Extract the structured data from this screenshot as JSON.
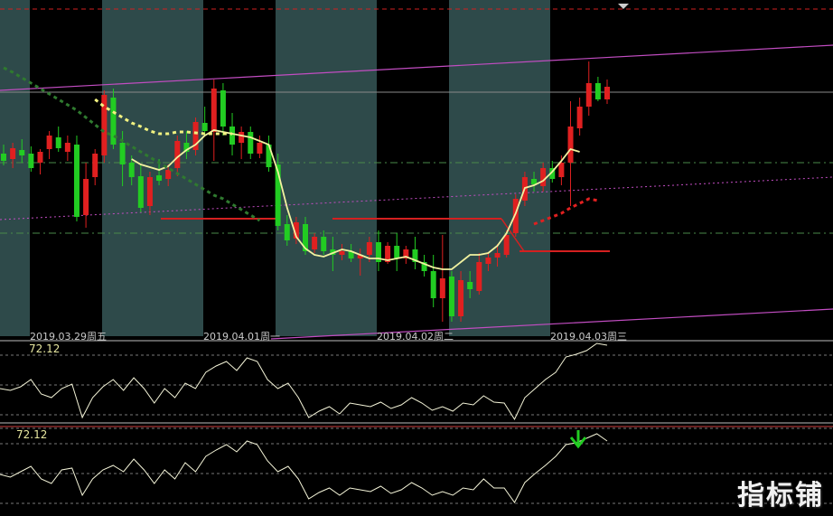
{
  "chart_data": [
    {
      "type": "candlestick",
      "title": "",
      "x_tick_labels": [
        "2019.03.29周五",
        "2019.04.01周一",
        "2019.04.02周二",
        "2019.04.03周三"
      ],
      "session_shading": true,
      "grid": true,
      "candles": [
        {
          "o": 170,
          "h": 160,
          "l": 183,
          "c": 178
        },
        {
          "o": 176,
          "h": 158,
          "l": 186,
          "c": 164
        },
        {
          "o": 166,
          "h": 154,
          "l": 180,
          "c": 172
        },
        {
          "o": 170,
          "h": 162,
          "l": 190,
          "c": 186
        },
        {
          "o": 180,
          "h": 165,
          "l": 193,
          "c": 168
        },
        {
          "o": 165,
          "h": 145,
          "l": 176,
          "c": 150
        },
        {
          "o": 152,
          "h": 140,
          "l": 168,
          "c": 164
        },
        {
          "o": 168,
          "h": 150,
          "l": 178,
          "c": 158
        },
        {
          "o": 160,
          "h": 150,
          "l": 245,
          "c": 240
        },
        {
          "o": 238,
          "h": 180,
          "l": 252,
          "c": 198
        },
        {
          "o": 196,
          "h": 165,
          "l": 205,
          "c": 170
        },
        {
          "o": 172,
          "h": 100,
          "l": 180,
          "c": 105
        },
        {
          "o": 108,
          "h": 98,
          "l": 165,
          "c": 160
        },
        {
          "o": 158,
          "h": 145,
          "l": 206,
          "c": 182
        },
        {
          "o": 180,
          "h": 172,
          "l": 205,
          "c": 196
        },
        {
          "o": 195,
          "h": 182,
          "l": 235,
          "c": 230
        },
        {
          "o": 228,
          "h": 190,
          "l": 238,
          "c": 196
        },
        {
          "o": 194,
          "h": 176,
          "l": 205,
          "c": 200
        },
        {
          "o": 198,
          "h": 182,
          "l": 206,
          "c": 188
        },
        {
          "o": 186,
          "h": 150,
          "l": 195,
          "c": 156
        },
        {
          "o": 158,
          "h": 145,
          "l": 176,
          "c": 168
        },
        {
          "o": 166,
          "h": 130,
          "l": 172,
          "c": 135
        },
        {
          "o": 136,
          "h": 118,
          "l": 150,
          "c": 145
        },
        {
          "o": 146,
          "h": 88,
          "l": 178,
          "c": 98
        },
        {
          "o": 100,
          "h": 92,
          "l": 150,
          "c": 140
        },
        {
          "o": 140,
          "h": 125,
          "l": 172,
          "c": 160
        },
        {
          "o": 158,
          "h": 140,
          "l": 176,
          "c": 146
        },
        {
          "o": 146,
          "h": 140,
          "l": 176,
          "c": 170
        },
        {
          "o": 170,
          "h": 150,
          "l": 175,
          "c": 158
        },
        {
          "o": 160,
          "h": 150,
          "l": 190,
          "c": 185
        },
        {
          "o": 182,
          "h": 170,
          "l": 255,
          "c": 250
        },
        {
          "o": 248,
          "h": 238,
          "l": 272,
          "c": 266
        },
        {
          "o": 264,
          "h": 240,
          "l": 270,
          "c": 246
        },
        {
          "o": 248,
          "h": 240,
          "l": 282,
          "c": 278
        },
        {
          "o": 276,
          "h": 258,
          "l": 280,
          "c": 262
        },
        {
          "o": 262,
          "h": 255,
          "l": 282,
          "c": 278
        },
        {
          "o": 276,
          "h": 262,
          "l": 300,
          "c": 282
        },
        {
          "o": 282,
          "h": 270,
          "l": 288,
          "c": 278
        },
        {
          "o": 278,
          "h": 270,
          "l": 290,
          "c": 286
        },
        {
          "o": 286,
          "h": 275,
          "l": 305,
          "c": 282
        },
        {
          "o": 282,
          "h": 262,
          "l": 290,
          "c": 268
        },
        {
          "o": 268,
          "h": 255,
          "l": 300,
          "c": 290
        },
        {
          "o": 290,
          "h": 268,
          "l": 292,
          "c": 272
        },
        {
          "o": 272,
          "h": 258,
          "l": 300,
          "c": 286
        },
        {
          "o": 286,
          "h": 272,
          "l": 292,
          "c": 276
        },
        {
          "o": 276,
          "h": 262,
          "l": 298,
          "c": 290
        },
        {
          "o": 290,
          "h": 282,
          "l": 306,
          "c": 300
        },
        {
          "o": 300,
          "h": 282,
          "l": 340,
          "c": 330
        },
        {
          "o": 330,
          "h": 260,
          "l": 356,
          "c": 308
        },
        {
          "o": 306,
          "h": 300,
          "l": 356,
          "c": 350
        },
        {
          "o": 350,
          "h": 300,
          "l": 356,
          "c": 310
        },
        {
          "o": 312,
          "h": 300,
          "l": 330,
          "c": 320
        },
        {
          "o": 322,
          "h": 280,
          "l": 326,
          "c": 290
        },
        {
          "o": 292,
          "h": 280,
          "l": 300,
          "c": 285
        },
        {
          "o": 285,
          "h": 270,
          "l": 295,
          "c": 280
        },
        {
          "o": 282,
          "h": 255,
          "l": 285,
          "c": 260
        },
        {
          "o": 258,
          "h": 215,
          "l": 262,
          "c": 220
        },
        {
          "o": 222,
          "h": 190,
          "l": 228,
          "c": 196
        },
        {
          "o": 198,
          "h": 190,
          "l": 212,
          "c": 204
        },
        {
          "o": 206,
          "h": 180,
          "l": 212,
          "c": 186
        },
        {
          "o": 186,
          "h": 178,
          "l": 202,
          "c": 198
        },
        {
          "o": 196,
          "h": 172,
          "l": 205,
          "c": 180
        },
        {
          "o": 180,
          "h": 112,
          "l": 228,
          "c": 140
        },
        {
          "o": 142,
          "h": 108,
          "l": 150,
          "c": 118
        },
        {
          "o": 118,
          "h": 68,
          "l": 128,
          "c": 92
        },
        {
          "o": 92,
          "h": 85,
          "l": 112,
          "c": 110
        },
        {
          "o": 110,
          "h": 88,
          "l": 115,
          "c": 96
        }
      ],
      "overlay_lines": [
        {
          "name": "",
          "color": "#f2f2a0",
          "style": "solid",
          "y": [
            null,
            null,
            null,
            null,
            null,
            null,
            null,
            null,
            null,
            null,
            null,
            null,
            null,
            null,
            176,
            182,
            185,
            188,
            184,
            174,
            166,
            160,
            150,
            144,
            146,
            148,
            150,
            152,
            156,
            160,
            190,
            230,
            262,
            275,
            282,
            284,
            280,
            276,
            278,
            282,
            286,
            286,
            288,
            286,
            284,
            288,
            292,
            296,
            298,
            298,
            290,
            282,
            282,
            280,
            272,
            258,
            236,
            208,
            205,
            200,
            190,
            178,
            165,
            168
          ]
        },
        {
          "name": "",
          "color": "#f2f280",
          "style": "dashed",
          "y": [
            null,
            null,
            null,
            null,
            null,
            null,
            null,
            null,
            null,
            null,
            110,
            118,
            124,
            130,
            136,
            140,
            145,
            148,
            148,
            146,
            146,
            147,
            148,
            148,
            148,
            148
          ]
        },
        {
          "name": "",
          "color": "#2f7a2f",
          "style": "dashed",
          "y": [
            75,
            80,
            86,
            92,
            98,
            104,
            110,
            116,
            122,
            130,
            138,
            146,
            150,
            156,
            162,
            168,
            174,
            180,
            186,
            192,
            198,
            204,
            210,
            216,
            220,
            226,
            232,
            238,
            244
          ]
        },
        {
          "name": "",
          "color": "#e02020",
          "style": "dashed",
          "y": [
            null,
            null,
            null,
            null,
            null,
            null,
            null,
            null,
            null,
            null,
            null,
            null,
            null,
            null,
            null,
            null,
            null,
            null,
            null,
            null,
            null,
            null,
            null,
            null,
            null,
            null,
            null,
            null,
            null,
            null,
            null,
            null,
            null,
            null,
            null,
            null,
            null,
            null,
            null,
            null,
            null,
            null,
            null,
            null,
            null,
            null,
            null,
            null,
            null,
            null,
            null,
            null,
            null,
            null,
            null,
            null,
            null,
            null,
            248,
            244,
            240,
            236,
            230,
            225,
            220,
            222
          ]
        }
      ]
    },
    {
      "type": "line",
      "title": "",
      "value_label": "72.12",
      "series": [
        {
          "name": "",
          "values": [
            430,
            432,
            428,
            420,
            436,
            440,
            430,
            425,
            462,
            440,
            428,
            420,
            432,
            418,
            430,
            446,
            430,
            440,
            424,
            430,
            412,
            405,
            400,
            410,
            396,
            400,
            420,
            430,
            424,
            440,
            462,
            455,
            450,
            458,
            446,
            448,
            450,
            445,
            452,
            448,
            440,
            446,
            454,
            450,
            455,
            446,
            448,
            438,
            445,
            446,
            464,
            440,
            430,
            420,
            412,
            395,
            392,
            388,
            380,
            382
          ]
        }
      ]
    },
    {
      "type": "line",
      "title": "",
      "value_label": "72.12",
      "signal_marker": "down-arrow",
      "series": [
        {
          "name": "",
          "values": [
            525,
            528,
            522,
            516,
            530,
            535,
            520,
            518,
            548,
            530,
            520,
            515,
            522,
            508,
            520,
            535,
            520,
            530,
            512,
            522,
            505,
            498,
            492,
            500,
            488,
            492,
            510,
            522,
            516,
            530,
            552,
            545,
            540,
            548,
            540,
            542,
            544,
            538,
            546,
            542,
            534,
            540,
            548,
            544,
            548,
            540,
            542,
            530,
            540,
            540,
            556,
            534,
            524,
            515,
            505,
            492,
            490,
            485,
            480,
            488
          ]
        }
      ]
    }
  ],
  "colors": {
    "up": "#e02020",
    "down": "#22cc22",
    "session_band": "#2e4a4a",
    "channel": "#c24dc2",
    "signal_arrow": "#22cc22"
  },
  "watermark": "指标铺"
}
